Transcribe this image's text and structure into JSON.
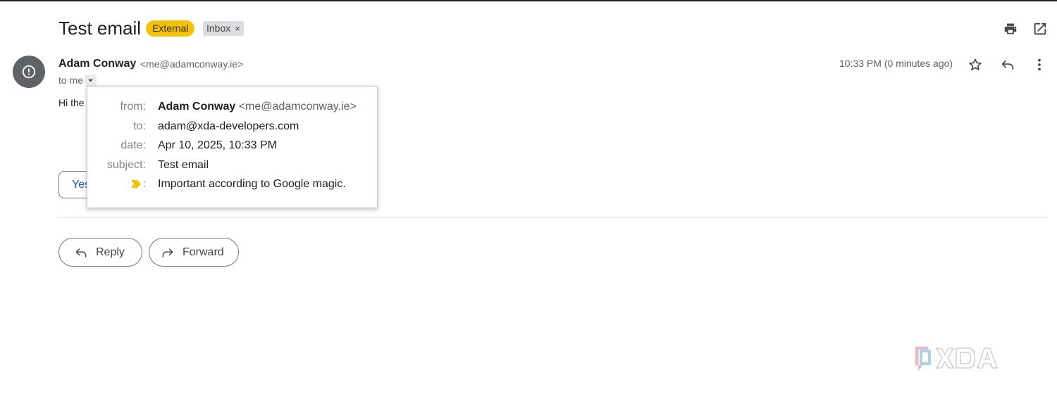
{
  "email": {
    "subject": "Test email",
    "labels": {
      "external": "External",
      "inbox": "Inbox",
      "inbox_remove": "×"
    },
    "sender": {
      "name": "Adam Conway",
      "email": "<me@adamconway.ie>"
    },
    "to_line": "to me",
    "timestamp": "10:33 PM (0 minutes ago)",
    "body_preview": "Hi the",
    "smart_reply_partial": "Yes"
  },
  "details_popup": {
    "from_label": "from:",
    "from_name": "Adam Conway",
    "from_email": "<me@adamconway.ie>",
    "to_label": "to:",
    "to_value": "adam@xda-developers.com",
    "date_label": "date:",
    "date_value": "Apr 10, 2025, 10:33 PM",
    "subject_label": "subject:",
    "subject_value": "Test email",
    "importance_colon": ":",
    "importance_value": "Important according to Google magic."
  },
  "actions": {
    "reply": "Reply",
    "forward": "Forward"
  },
  "icons": {
    "print": "print-icon",
    "open_new_window": "open-in-new-icon",
    "star": "star-icon",
    "reply": "reply-icon",
    "more": "more-vert-icon",
    "avatar": "alert-icon",
    "importance": "importance-marker-icon"
  },
  "colors": {
    "external_chip": "#f4c20d",
    "importance_marker": "#f4c20d",
    "link_blue": "#0b57d0"
  }
}
